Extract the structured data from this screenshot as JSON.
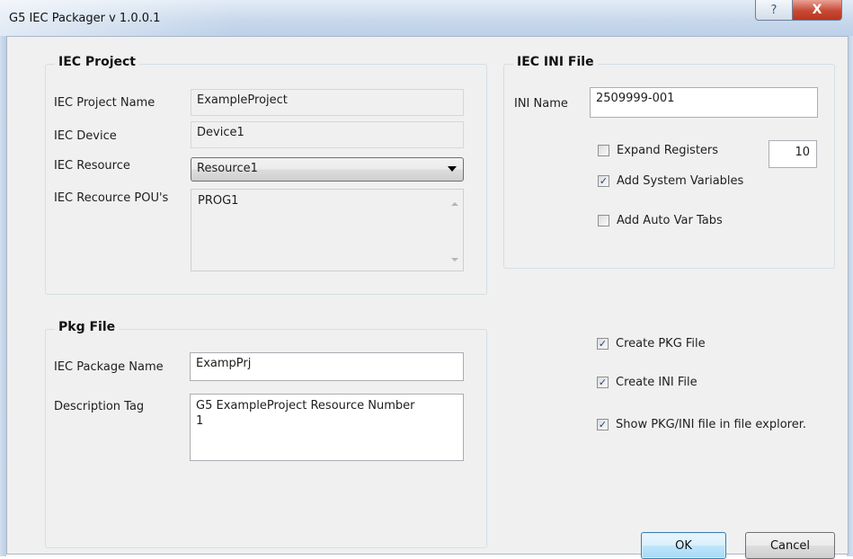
{
  "window": {
    "title": "G5 IEC Packager v 1.0.0.1",
    "help_glyph": "?",
    "close_glyph": "X"
  },
  "iec_project": {
    "legend": "IEC Project",
    "project_name_label": "IEC Project Name",
    "project_name_value": "ExampleProject",
    "device_label": "IEC Device",
    "device_value": "Device1",
    "resource_label": "IEC Resource",
    "resource_selected": "Resource1",
    "pous_label": "IEC Recource POU's",
    "pous": [
      "PROG1"
    ]
  },
  "pkg_file": {
    "legend": "Pkg File",
    "package_name_label": "IEC Package Name",
    "package_name_value": "ExampPrj",
    "description_label": "Description Tag",
    "description_line1": "G5 ExampleProject Resource Number",
    "description_line2": "1"
  },
  "iec_ini": {
    "legend": "IEC INI File",
    "ini_name_label": "INI Name",
    "ini_name_value": "2509999-001",
    "expand_registers_label": "Expand Registers",
    "expand_registers_checked": false,
    "expand_registers_count": "10",
    "add_system_vars_label": "Add System Variables",
    "add_system_vars_checked": true,
    "add_auto_var_tabs_label": "Add Auto Var Tabs",
    "add_auto_var_tabs_checked": false
  },
  "options": {
    "create_pkg_label": "Create PKG File",
    "create_pkg_checked": true,
    "create_ini_label": "Create INI File",
    "create_ini_checked": true,
    "show_explorer_label": "Show PKG/INI file in file explorer.",
    "show_explorer_checked": true
  },
  "buttons": {
    "ok": "OK",
    "cancel": "Cancel"
  },
  "check_glyph": "✓",
  "colors": {
    "title_bar": "#c9d9ec",
    "close_button": "#c74a35",
    "default_button_border": "#3c7fb1"
  }
}
